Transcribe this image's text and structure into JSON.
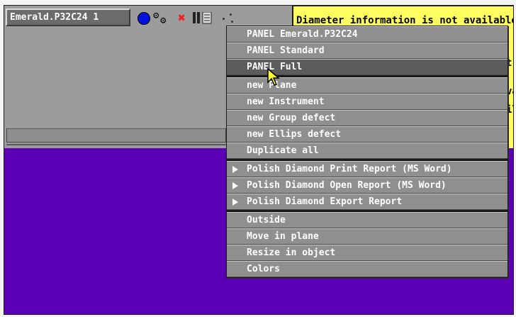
{
  "toolbar": {
    "title": "Emerald.P32C24 1",
    "icons": [
      "blue-circle",
      "gears",
      "red-x",
      "panel",
      "dots"
    ]
  },
  "info_box": {
    "lines": [
      "Diameter information is not available",
      "t a",
      "va",
      "il"
    ]
  },
  "menu": {
    "items": [
      {
        "label": "PANEL Emerald.P32C24",
        "highlighted": false,
        "submenu": false
      },
      {
        "label": "PANEL Standard",
        "highlighted": false,
        "submenu": false
      },
      {
        "label": "PANEL Full",
        "highlighted": true,
        "submenu": false
      },
      {
        "label": "new Plane",
        "highlighted": false,
        "submenu": false
      },
      {
        "label": "new Instrument",
        "highlighted": false,
        "submenu": false
      },
      {
        "label": "new Group defect",
        "highlighted": false,
        "submenu": false
      },
      {
        "label": "new Ellips defect",
        "highlighted": false,
        "submenu": false
      },
      {
        "label": "Duplicate all",
        "highlighted": false,
        "submenu": false
      },
      {
        "label": "Polish Diamond Print Report (MS Word)",
        "highlighted": false,
        "submenu": true
      },
      {
        "label": "Polish Diamond Open Report (MS Word)",
        "highlighted": false,
        "submenu": true
      },
      {
        "label": "Polish Diamond Export Report",
        "highlighted": false,
        "submenu": true
      },
      {
        "label": "Outside",
        "highlighted": false,
        "submenu": false
      },
      {
        "label": "Move in plane",
        "highlighted": false,
        "submenu": false
      },
      {
        "label": "Resize in object",
        "highlighted": false,
        "submenu": false
      },
      {
        "label": "Colors",
        "highlighted": false,
        "submenu": false
      }
    ]
  },
  "colors": {
    "toolbar_bg": "#9c9c9c",
    "info_bg": "#ffff60",
    "canvas_bg": "#5c00b8",
    "menu_bg": "#8f8f8f",
    "menu_highlight": "#5c5c5c"
  }
}
